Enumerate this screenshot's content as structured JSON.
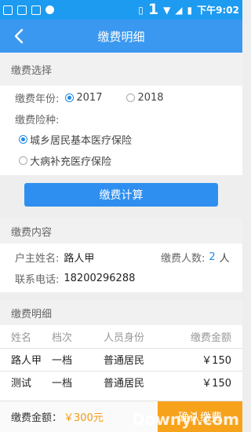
{
  "status": {
    "big": "1",
    "time": "下午9:02"
  },
  "header": {
    "title": "缴费明细"
  },
  "selection": {
    "section_title": "缴费选择",
    "year_label": "缴费年份:",
    "years": [
      "2017",
      "2018"
    ],
    "selected_year": "2017",
    "insurance_label": "缴费险种:",
    "insurances": [
      "城乡居民基本医疗保险",
      "大病补充医疗保险"
    ],
    "selected_insurance": "城乡居民基本医疗保险"
  },
  "calculate_label": "缴费计算",
  "content": {
    "section_title": "缴费内容",
    "owner_label": "户主姓名:",
    "owner_value": "路人甲",
    "count_label": "缴费人数:",
    "count_value": "2",
    "count_unit": "人",
    "phone_label": "联系电话:",
    "phone_value": "18200296288"
  },
  "detail": {
    "section_title": "缴费明细",
    "columns": [
      "姓名",
      "档次",
      "人员身份",
      "缴费金额"
    ],
    "rows": [
      [
        "路人甲",
        "一档",
        "普通居民",
        "￥150"
      ],
      [
        "测试",
        "一档",
        "普通居民",
        "￥150"
      ]
    ]
  },
  "footer": {
    "amount_label": "缴费金额：",
    "amount_value": "￥300元",
    "pay_label": "确认缴费",
    "watermark": "Downyi.com"
  },
  "colors": {
    "primary": "#3b98f0",
    "accent": "#f7a21b",
    "radio": "#1d8ae8"
  }
}
